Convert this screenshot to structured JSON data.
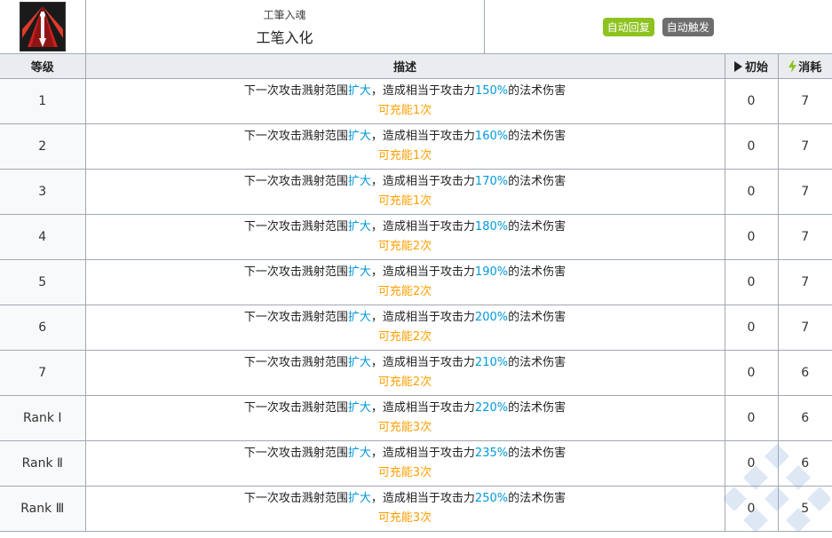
{
  "skill": {
    "icon": "skill-icon-red-brush",
    "subtitle": "工筆入魂",
    "name": "工笔入化",
    "tags": [
      {
        "label": "自动回复",
        "color": "#8ec31f"
      },
      {
        "label": "自动触发",
        "color": "#6e6e6e"
      }
    ]
  },
  "columns": {
    "level": "等级",
    "description": "描述",
    "initial": "初始",
    "cost": "消耗"
  },
  "rows": [
    {
      "level": "1",
      "desc_a": "下一次攻击溅射范围",
      "desc_b": "扩大",
      "desc_c": "，造成相当于攻击力",
      "desc_d": "150%",
      "desc_e": "的法术伤害",
      "charge": "可充能1次",
      "initial": "0",
      "cost": "7"
    },
    {
      "level": "2",
      "desc_a": "下一次攻击溅射范围",
      "desc_b": "扩大",
      "desc_c": "，造成相当于攻击力",
      "desc_d": "160%",
      "desc_e": "的法术伤害",
      "charge": "可充能1次",
      "initial": "0",
      "cost": "7"
    },
    {
      "level": "3",
      "desc_a": "下一次攻击溅射范围",
      "desc_b": "扩大",
      "desc_c": "，造成相当于攻击力",
      "desc_d": "170%",
      "desc_e": "的法术伤害",
      "charge": "可充能1次",
      "initial": "0",
      "cost": "7"
    },
    {
      "level": "4",
      "desc_a": "下一次攻击溅射范围",
      "desc_b": "扩大",
      "desc_c": "，造成相当于攻击力",
      "desc_d": "180%",
      "desc_e": "的法术伤害",
      "charge": "可充能2次",
      "initial": "0",
      "cost": "7"
    },
    {
      "level": "5",
      "desc_a": "下一次攻击溅射范围",
      "desc_b": "扩大",
      "desc_c": "，造成相当于攻击力",
      "desc_d": "190%",
      "desc_e": "的法术伤害",
      "charge": "可充能2次",
      "initial": "0",
      "cost": "7"
    },
    {
      "level": "6",
      "desc_a": "下一次攻击溅射范围",
      "desc_b": "扩大",
      "desc_c": "，造成相当于攻击力",
      "desc_d": "200%",
      "desc_e": "的法术伤害",
      "charge": "可充能2次",
      "initial": "0",
      "cost": "7"
    },
    {
      "level": "7",
      "desc_a": "下一次攻击溅射范围",
      "desc_b": "扩大",
      "desc_c": "，造成相当于攻击力",
      "desc_d": "210%",
      "desc_e": "的法术伤害",
      "charge": "可充能2次",
      "initial": "0",
      "cost": "6"
    },
    {
      "level": "Rank Ⅰ",
      "desc_a": "下一次攻击溅射范围",
      "desc_b": "扩大",
      "desc_c": "，造成相当于攻击力",
      "desc_d": "220%",
      "desc_e": "的法术伤害",
      "charge": "可充能3次",
      "initial": "0",
      "cost": "6"
    },
    {
      "level": "Rank Ⅱ",
      "desc_a": "下一次攻击溅射范围",
      "desc_b": "扩大",
      "desc_c": "，造成相当于攻击力",
      "desc_d": "235%",
      "desc_e": "的法术伤害",
      "charge": "可充能3次",
      "initial": "0",
      "cost": "6"
    },
    {
      "level": "Rank Ⅲ",
      "desc_a": "下一次攻击溅射范围",
      "desc_b": "扩大",
      "desc_c": "，造成相当于攻击力",
      "desc_d": "250%",
      "desc_e": "的法术伤害",
      "charge": "可充能3次",
      "initial": "0",
      "cost": "5"
    }
  ],
  "colors": {
    "highlight": "#0098dc",
    "charge": "#ff9f00",
    "header_bg": "#eaecf0",
    "level_bg": "#f8f9fa",
    "border": "#a2a9b1"
  },
  "watermark_icon": "diamond-watermark-icon"
}
